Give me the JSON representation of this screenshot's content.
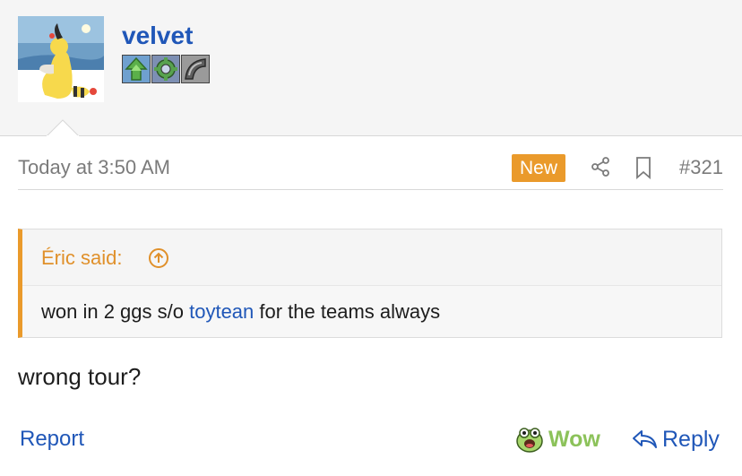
{
  "user": {
    "name": "velvet",
    "avatar_icon": "ampharos-avatar-icon",
    "badges": [
      "grass-badge-icon",
      "gear-badge-icon",
      "stone-badge-icon"
    ]
  },
  "post": {
    "timestamp": "Today at 3:50 AM",
    "new_label": "New",
    "number": "#321",
    "share_icon": "share-icon",
    "bookmark_icon": "bookmark-icon",
    "message": "wrong tour?"
  },
  "quote": {
    "author": "Éric said:",
    "body_before": "won in 2 ggs s/o ",
    "body_link": "toytean",
    "body_after": " for the teams always"
  },
  "actions": {
    "report": "Report",
    "reaction": "Wow",
    "reply": "Reply"
  },
  "colors": {
    "link_blue": "#2057b8",
    "accent_orange": "#ea9a2b",
    "wow_green": "#8cc25a",
    "muted_gray": "#7b7b7b"
  }
}
